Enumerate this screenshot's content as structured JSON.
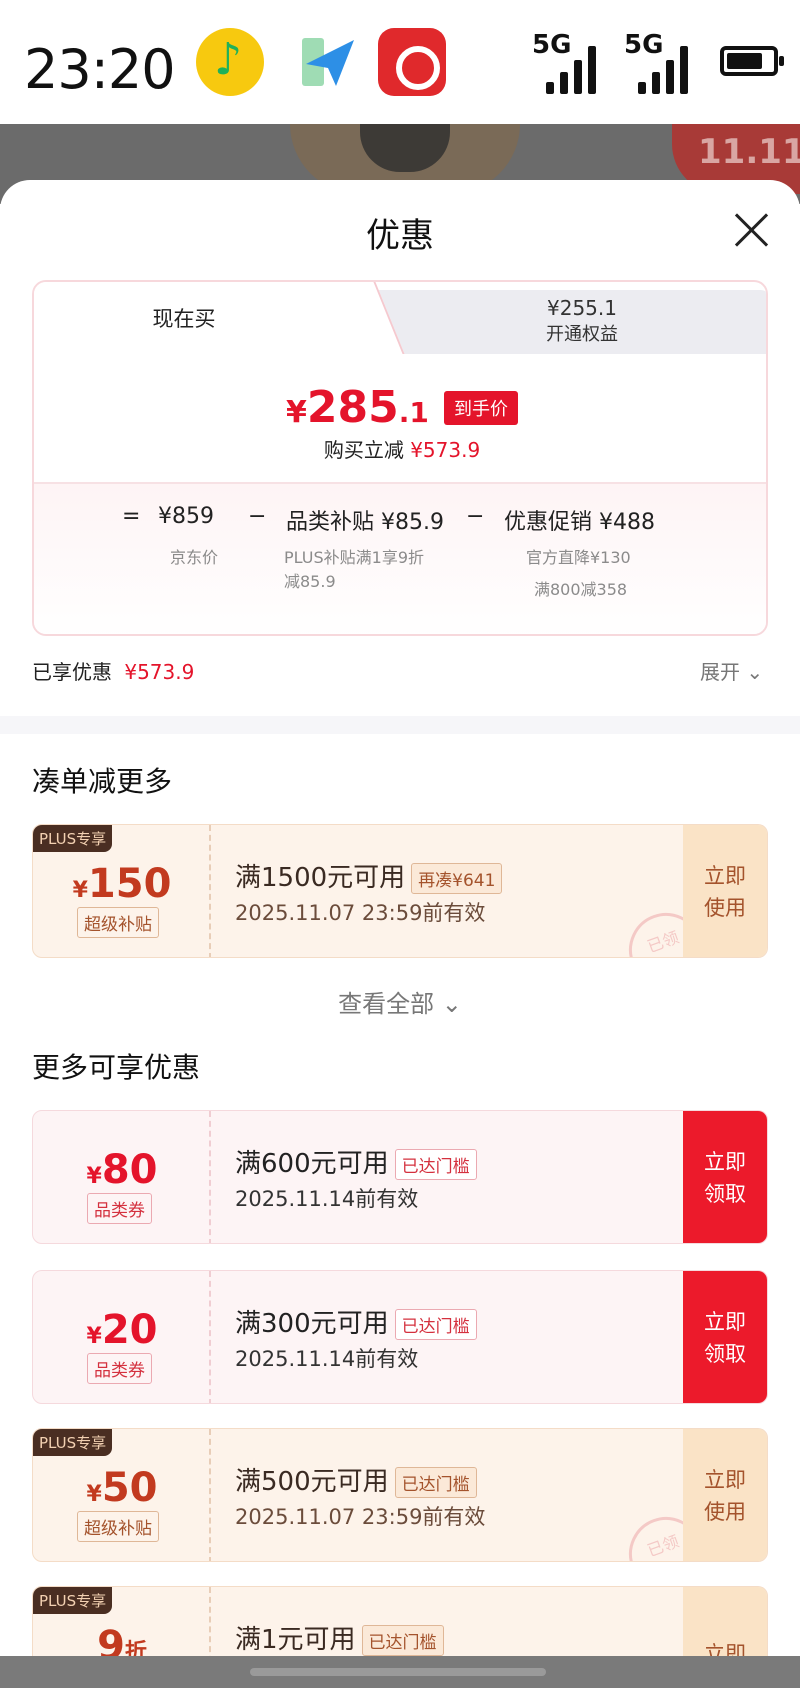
{
  "status_bar": {
    "time": "23:20",
    "signal_labels": [
      "5G",
      "5G"
    ],
    "battery_level": 0.8,
    "apps": [
      "qq-music-icon",
      "send-arrow-icon",
      "netease-music-icon"
    ]
  },
  "sheet": {
    "title": "优惠",
    "tabs": {
      "now_label": "现在买",
      "plus_price": "¥255.1",
      "plus_label": "开通权益"
    },
    "price": {
      "yen": "¥",
      "int": "285",
      "dec": ".1",
      "tag": "到手价",
      "saving_label": "购买立减",
      "saving_value": "¥573.9"
    },
    "breakdown": {
      "eq": "=",
      "jd_price": "¥859",
      "jd_label": "京东价",
      "minus1": "−",
      "category_label": "品类补贴 ¥85.9",
      "category_sub1": "PLUS补贴满1享9折",
      "category_sub2": "减85.9",
      "minus2": "−",
      "promo_label": "优惠促销 ¥488",
      "promo_sub1": "官方直降¥130",
      "promo_sub2": "满800减358"
    },
    "enjoyed_label": "已享优惠",
    "enjoyed_value": "¥573.9",
    "expand_label": "展开 ⌄"
  },
  "section1": {
    "title": "凑单减更多",
    "view_all": "查看全部 ⌄"
  },
  "section2": {
    "title": "更多可享优惠"
  },
  "coupons": [
    {
      "plus_tag": "PLUS专享",
      "yen": "¥",
      "amount": "150",
      "kind": "超级补贴",
      "condition": "满1500元可用",
      "chip": "再凑¥641",
      "date": "2025.11.07 23:59前有效",
      "action_line1": "立即",
      "action_line2": "使用",
      "stamp": "已领"
    },
    {
      "yen": "¥",
      "amount": "80",
      "kind": "品类券",
      "condition": "满600元可用",
      "chip": "已达门槛",
      "date": "2025.11.14前有效",
      "action_line1": "立即",
      "action_line2": "领取"
    },
    {
      "yen": "¥",
      "amount": "20",
      "kind": "品类券",
      "condition": "满300元可用",
      "chip": "已达门槛",
      "date": "2025.11.14前有效",
      "action_line1": "立即",
      "action_line2": "领取"
    },
    {
      "plus_tag": "PLUS专享",
      "yen": "¥",
      "amount": "50",
      "kind": "超级补贴",
      "condition": "满500元可用",
      "chip": "已达门槛",
      "date": "2025.11.07 23:59前有效",
      "action_line1": "立即",
      "action_line2": "使用",
      "stamp": "已领"
    },
    {
      "plus_tag": "PLUS专享",
      "amount": "9",
      "unit": "折",
      "condition": "满1元可用",
      "chip": "已达门槛",
      "action_line1": "立即"
    }
  ],
  "background": {
    "badge_text": "11.11"
  },
  "colors": {
    "accent_red": "#e4142b",
    "plus_brown": "#4a2e22",
    "plus_bg": "#fdf3ea"
  }
}
